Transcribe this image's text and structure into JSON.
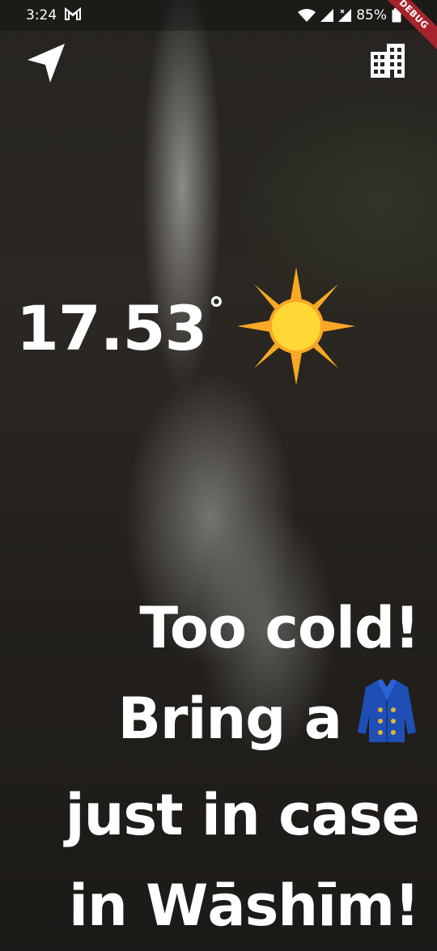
{
  "status_bar": {
    "time": "3:24",
    "gmail_icon": "gmail-icon",
    "battery": "85%"
  },
  "debug_banner": "DEBUG",
  "nav": {
    "location_icon": "navigation-arrow-icon",
    "city_icon": "city-buildings-icon"
  },
  "weather": {
    "temperature": "17.53",
    "unit": "°",
    "condition_icon": "sun-icon"
  },
  "message": {
    "line1": "Too cold!",
    "line2": "Bring a",
    "line2_icon": "coat-icon",
    "line3": "just in case",
    "line4": "in Wāshīm!"
  },
  "colors": {
    "sun": "#fbc02d",
    "sun_rays": "#f9a825",
    "coat": "#1f4fb5",
    "debug_banner": "#a5232d"
  }
}
